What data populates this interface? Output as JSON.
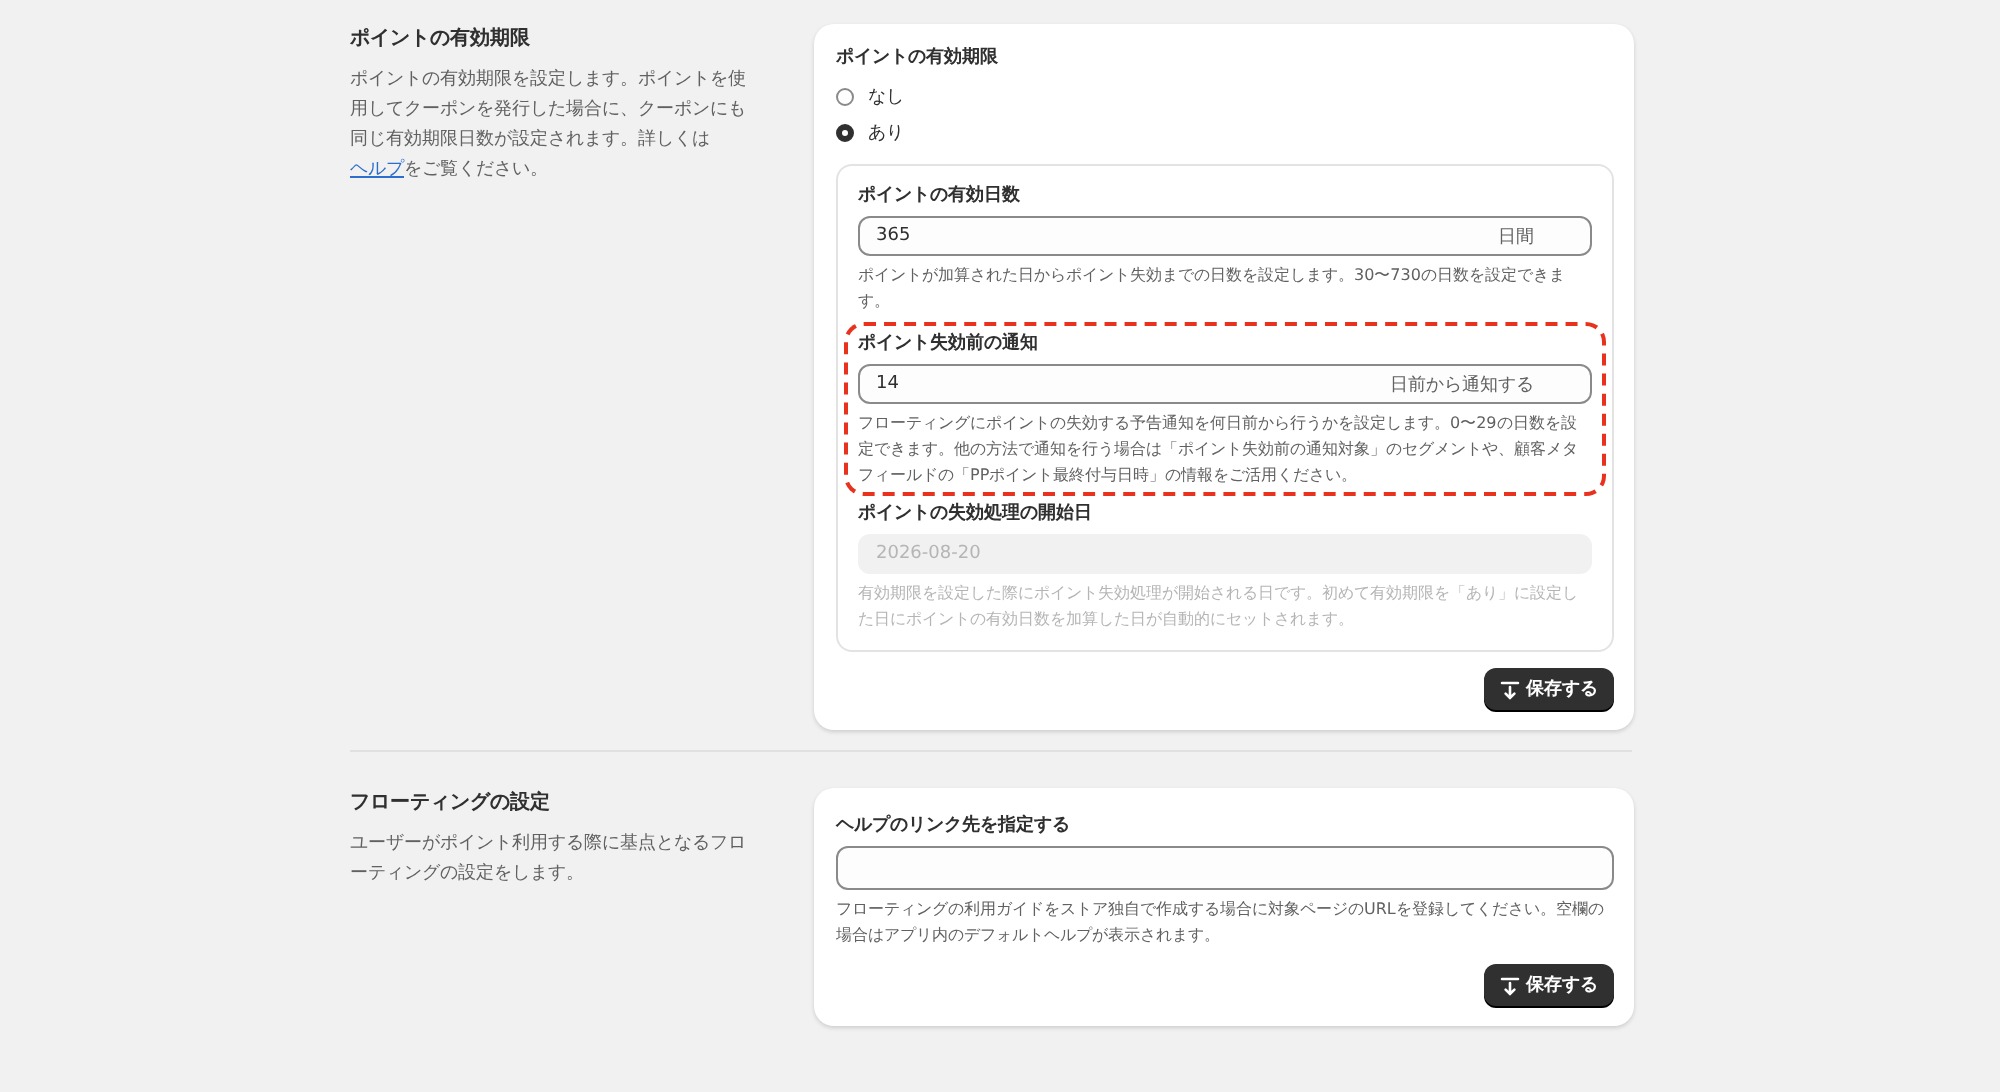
{
  "sections": [
    {
      "title": "ポイントの有効期限",
      "description": {
        "before": "ポイントの有効期限を設定します。ポイントを使用してクーポンを発行した場合に、クーポンにも同じ有効期限日数が設定されます。詳しくは",
        "link": "ヘルプ",
        "after": "をご覧ください。"
      },
      "card": {
        "label": "ポイントの有効期限",
        "radios": [
          {
            "label": "なし",
            "selected": false
          },
          {
            "label": "あり",
            "selected": true
          }
        ],
        "panel": {
          "fields": [
            {
              "label": "ポイントの有効日数",
              "value": "365",
              "suffix": "日間",
              "help": "ポイントが加算された日からポイント失効までの日数を設定します。30〜730の日数を設定できます。",
              "disabled": false
            },
            {
              "label": "ポイント失効前の通知",
              "value": "14",
              "suffix": "日前から通知する",
              "help": "フローティングにポイントの失効する予告通知を何日前から行うかを設定します。0〜29の日数を設定できます。他の方法で通知を行う場合は「ポイント失効前の通知対象」のセグメントや、顧客メタフィールドの「PPポイント最終付与日時」の情報をご活用ください。",
              "disabled": false,
              "highlighted": true
            },
            {
              "label": "ポイントの失効処理の開始日",
              "value": "2026-08-20",
              "help": "有効期限を設定した際にポイント失効処理が開始される日です。初めて有効期限を「あり」に設定した日にポイントの有効日数を加算した日が自動的にセットされます。",
              "disabled": true
            }
          ]
        },
        "save_button": "保存する"
      }
    },
    {
      "title": "フローティングの設定",
      "description": {
        "before": "ユーザーがポイント利用する際に基点となるフローティングの設定をします。"
      },
      "card": {
        "fields": [
          {
            "label": "ヘルプのリンク先を指定する",
            "help": "フローティングの利用ガイドをストア独自で作成する場合に対象ページのURLを登録してください。空欄の場合はアプリ内のデフォルトヘルプが表示されます。",
            "disabled": false
          }
        ],
        "save_button": "保存する"
      }
    }
  ]
}
